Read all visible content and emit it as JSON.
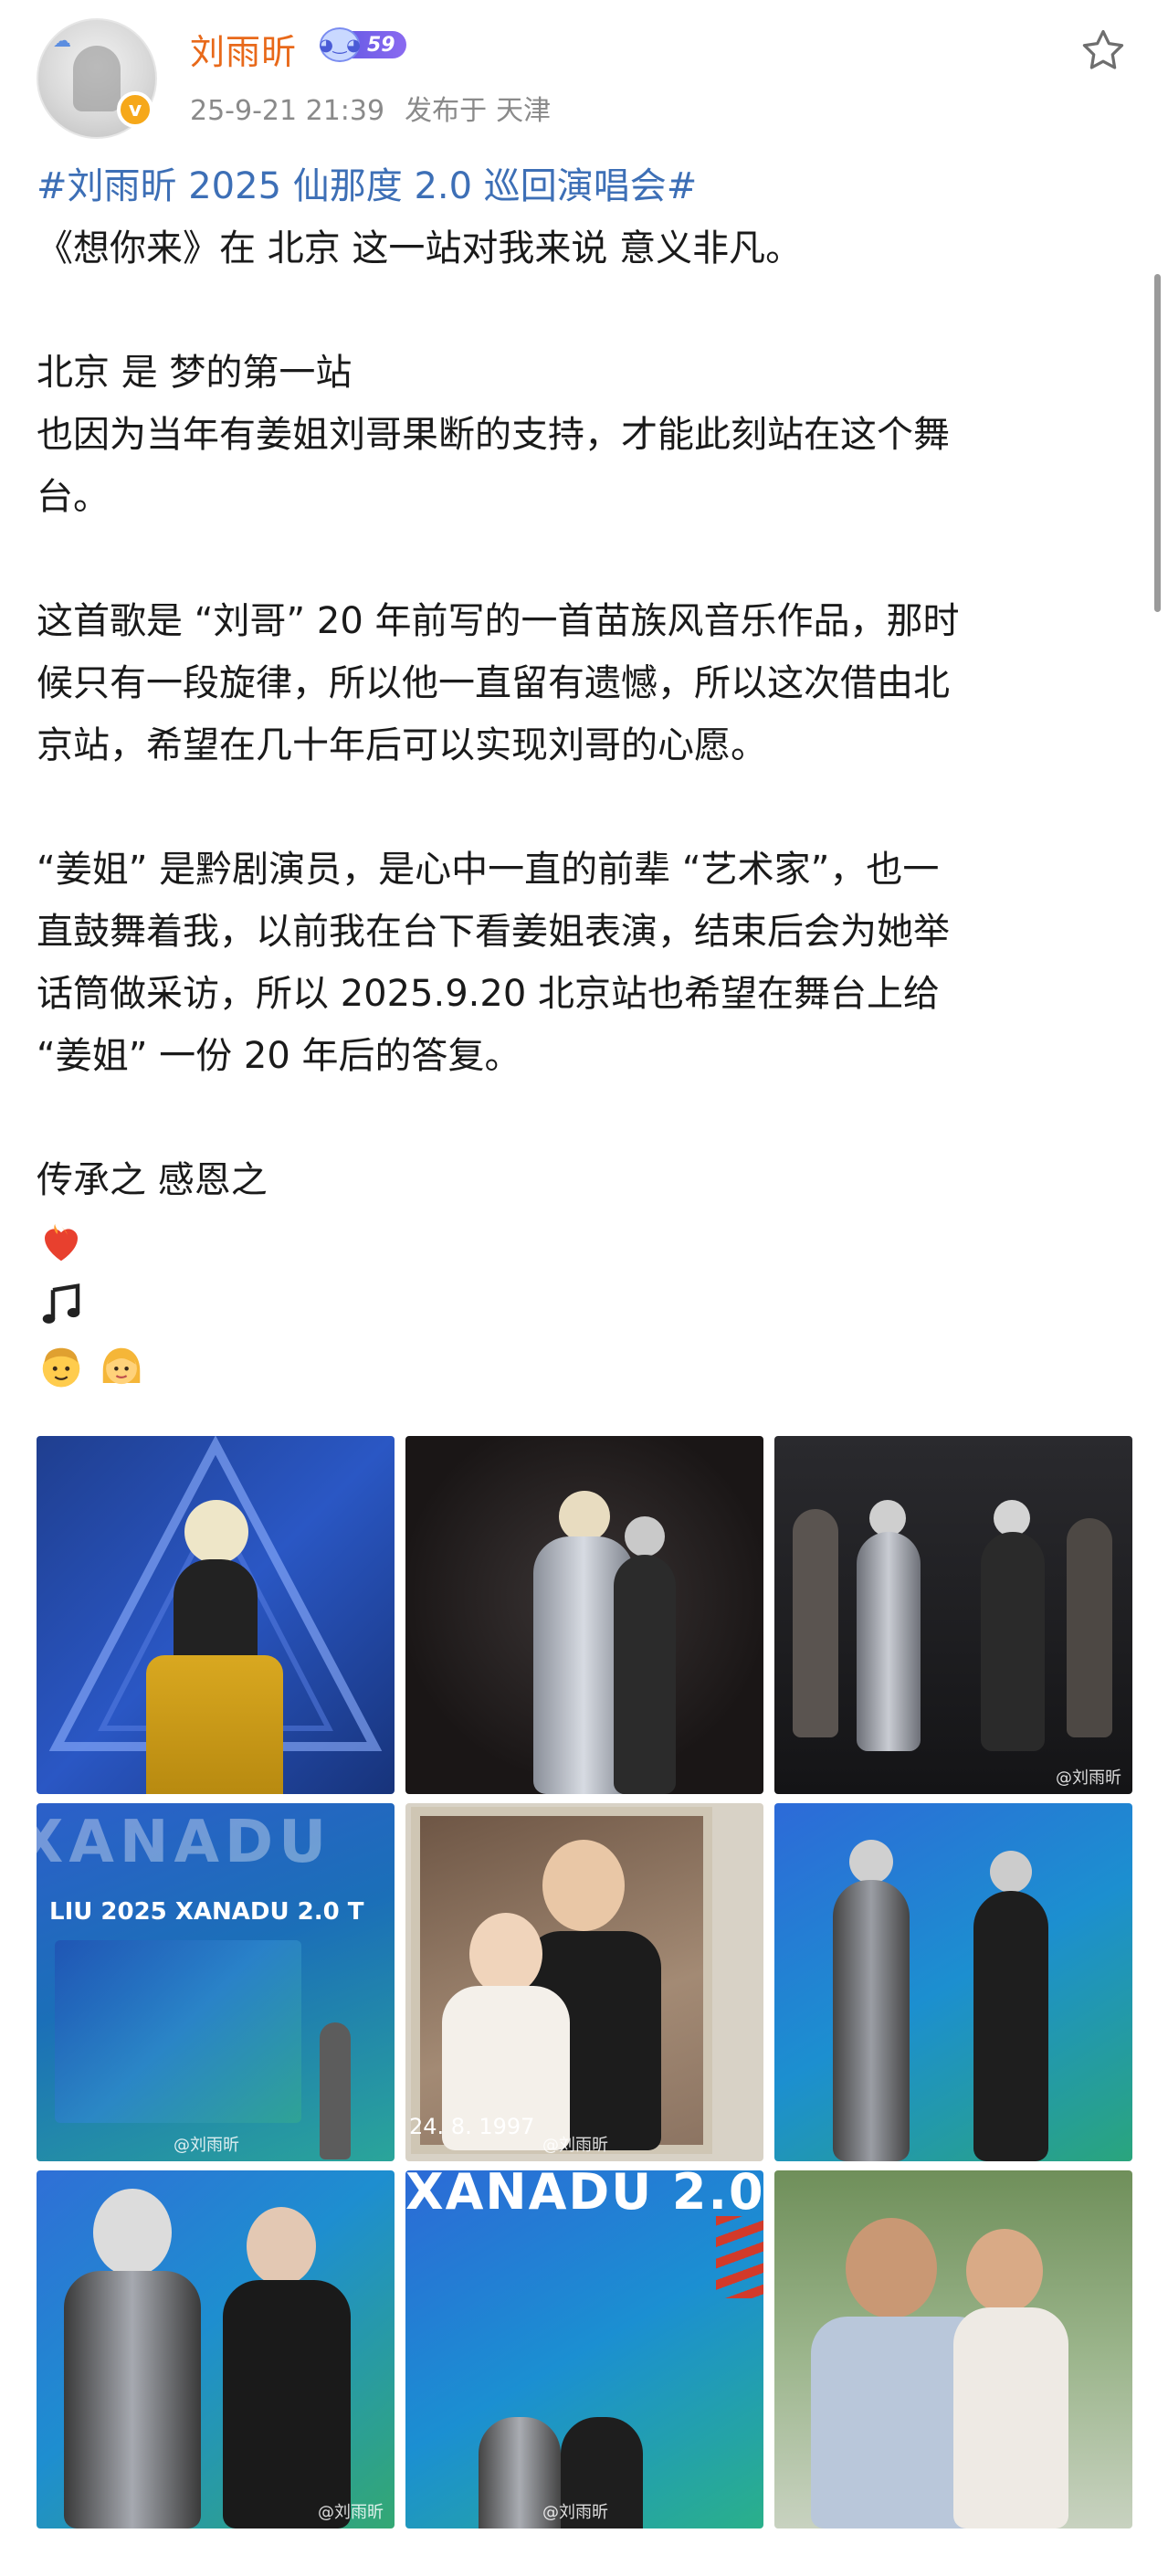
{
  "post": {
    "username": "刘雨昕",
    "level": "59",
    "timestamp": "25-9-21 21:39",
    "published_label": "发布于",
    "location": "天津",
    "verified_icon": "verified-badge-icon",
    "favorite_icon": "star-outline-icon"
  },
  "content": {
    "hashtag": "#刘雨昕 2025 仙那度 2.0 巡回演唱会#",
    "lines": [
      "《想你来》在 北京 这一站对我来说 意义非凡。",
      "",
      "北京 是 梦的第一站",
      "也因为当年有姜姐刘哥果断的支持，才能此刻站在这个舞",
      "台。",
      "",
      "这首歌是 “刘哥” 20 年前写的一首苗族风音乐作品，那时",
      "候只有一段旋律，所以他一直留有遗憾，所以这次借由北",
      "京站，希望在几十年后可以实现刘哥的心愿。",
      "",
      "“姜姐” 是黔剧演员，是心中一直的前辈 “艺术家”，也一",
      "直鼓舞着我，以前我在台下看姜姐表演，结束后会为她举",
      "话筒做采访，所以 2025.9.20 北京站也希望在舞台上给",
      "“姜姐” 一份 20 年后的答复。",
      "",
      "传承之  感恩之"
    ],
    "emoji_rows": [
      [
        "heart-on-fire-emoji"
      ],
      [
        "music-notes-emoji"
      ],
      [
        "man-emoji",
        "woman-emoji"
      ]
    ]
  },
  "photos": {
    "watermark": "@刘雨昕",
    "tour_banner": "LIU  2025  XANADU 2.0  T",
    "big_banner": "XANADU 2.0",
    "photo_date": "24. 8. 1997"
  }
}
